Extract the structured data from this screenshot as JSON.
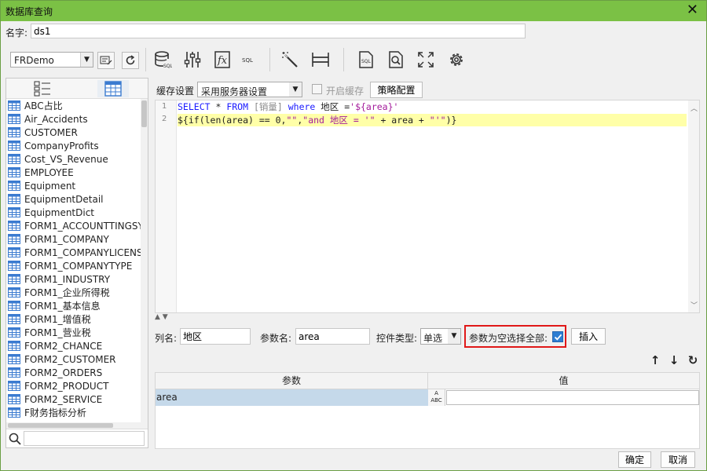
{
  "window": {
    "title": "数据库查询",
    "close_glyph": "✕"
  },
  "name_field": {
    "label": "名字:",
    "value": "ds1"
  },
  "toolbar": {
    "datasource": "FRDemo",
    "icons": [
      "edit-connection-icon",
      "refresh-icon",
      "database-sql-icon",
      "sliders-icon",
      "function-icon",
      "sql-text-icon",
      "magic-wand-icon",
      "layout-icon",
      "sql-file-icon",
      "preview-icon",
      "fullscreen-icon",
      "settings-gear-icon"
    ]
  },
  "left_panel": {
    "tables": [
      "ABC占比",
      "Air_Accidents",
      "CUSTOMER",
      "CompanyProfits",
      "Cost_VS_Revenue",
      "EMPLOYEE",
      "Equipment",
      "EquipmentDetail",
      "EquipmentDict",
      "FORM1_ACCOUNTTINGSY",
      "FORM1_COMPANY",
      "FORM1_COMPANYLICENS",
      "FORM1_COMPANYTYPE",
      "FORM1_INDUSTRY",
      "FORM1_企业所得税",
      "FORM1_基本信息",
      "FORM1_增值税",
      "FORM1_营业税",
      "FORM2_CHANCE",
      "FORM2_CUSTOMER",
      "FORM2_ORDERS",
      "FORM2_PRODUCT",
      "FORM2_SERVICE",
      "F财务指标分析"
    ]
  },
  "cache": {
    "label": "缓存设置",
    "selected": "采用服务器设置",
    "enable_label": "开启缓存",
    "strategy_button": "策略配置"
  },
  "editor": {
    "line_numbers": [
      "1",
      "2"
    ],
    "line1": {
      "kw1": "SELECT",
      "star": " * ",
      "kw2": "FROM",
      "table": " [销量] ",
      "kw3": "where",
      "col": " 地区 =",
      "str": "'${area}'"
    },
    "line2": {
      "a": "${if(len(area) == 0,",
      "b": "\"\"",
      "c": ",",
      "d": "\"and 地区 = '\"",
      "e": " + area + ",
      "f": "\"'\"",
      "g": ")}"
    }
  },
  "param_row": {
    "column_label": "列名:",
    "column_value": "地区",
    "param_label": "参数名:",
    "param_value": "area",
    "control_label": "控件类型:",
    "control_value": "单选",
    "select_all_label": "参数为空选择全部:",
    "select_all_checked": true,
    "insert_button": "插入"
  },
  "param_table": {
    "headers": [
      "参数",
      "值"
    ],
    "rows": [
      {
        "param": "area",
        "type_badge_top": "A",
        "type_badge": "ABC",
        "value": ""
      }
    ]
  },
  "footer": {
    "ok": "确定",
    "cancel": "取消"
  }
}
